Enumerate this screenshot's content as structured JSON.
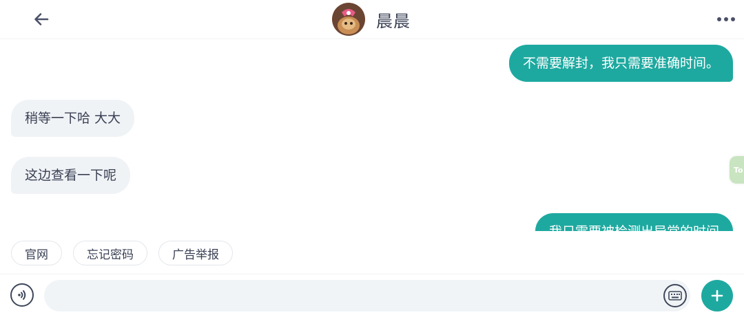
{
  "header": {
    "back_icon": "arrow-left-icon",
    "title": "晨晨",
    "more_icon": "more-horizontal-icon"
  },
  "messages": [
    {
      "direction": "out",
      "text": "不需要解封，我只需要准确时间。"
    },
    {
      "direction": "in",
      "text": "稍等一下哈 大大"
    },
    {
      "direction": "in",
      "text": "这边查看一下呢"
    },
    {
      "direction": "out",
      "text": "我只需要被检测出异常的时间"
    }
  ],
  "float_tab": {
    "text": "To"
  },
  "quick_replies": [
    "官网",
    "忘记密码",
    "广告举报"
  ],
  "input": {
    "placeholder": "",
    "value": "",
    "voice_icon": "voice-icon",
    "keyboard_icon": "keyboard-icon",
    "plus_icon": "plus-icon"
  },
  "colors": {
    "accent": "#1ea9a0",
    "incoming_bubble": "#f0f3f6",
    "text": "#3a4054"
  }
}
